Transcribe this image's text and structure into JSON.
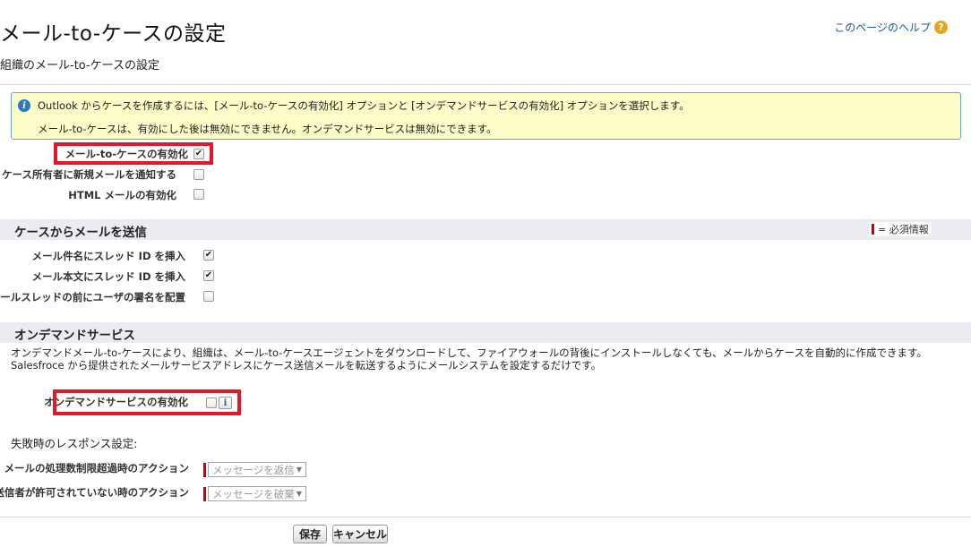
{
  "header": {
    "title": "メール-to-ケースの設定",
    "subtitle": "組織のメール-to-ケースの設定",
    "help_label": "このページのヘルプ",
    "help_icon": "?"
  },
  "info": {
    "icon": "i",
    "line1": "Outlook からケースを作成するには、[メール-to-ケースの有効化] オプションと [オンデマンドサービスの有効化] オプションを選択します。",
    "line2": "メール-to-ケースは、有効にした後は無効にできません。オンデマンドサービスは無効にできます。"
  },
  "general_settings": [
    {
      "label": "メール-to-ケースの有効化",
      "checked": true,
      "mark": "✔"
    },
    {
      "label": "ケース所有者に新規メールを通知する",
      "checked": false,
      "mark": ""
    },
    {
      "label": "HTML メールの有効化",
      "checked": false,
      "mark": ""
    }
  ],
  "send_section": {
    "title": "ケースからメールを送信",
    "required_legend": "= 必須情報",
    "rows": [
      {
        "label": "メール件名にスレッド ID を挿入",
        "checked": true,
        "mark": "✔"
      },
      {
        "label": "メール本文にスレッド ID を挿入",
        "checked": true,
        "mark": "✔"
      },
      {
        "label": "メールスレッドの前にユーザの署名を配置",
        "checked": false,
        "mark": ""
      }
    ]
  },
  "ondemand_section": {
    "title": "オンデマンドサービス",
    "description": "オンデマンドメール-to-ケースにより、組織は、メール-to-ケースエージェントをダウンロードして、ファイアウォールの背後にインストールしなくても、メールからケースを自動的に作成できます。Salesfroce から提供されたメールサービスアドレスにケース送信メールを転送するようにメールシステムを設定するだけです。",
    "enable_label": "オンデマンドサービスの有効化",
    "enable_checked": false,
    "info_button": "i",
    "failure_heading": "失敗時のレスポンス設定:",
    "actions": [
      {
        "label": "メールの処理数制限超過時のアクション",
        "selected": "メッセージを返信"
      },
      {
        "label": "送信者が許可されていない時のアクション",
        "selected": "メッセージを破棄"
      }
    ]
  },
  "buttons": {
    "save": "保存",
    "cancel": "キャンセル"
  },
  "colors": {
    "highlight_border": "#e01a2a",
    "info_background": "#fcfcc8",
    "section_background": "#eaecf2",
    "required": "#cc0000",
    "link": "#1a5aa0"
  }
}
